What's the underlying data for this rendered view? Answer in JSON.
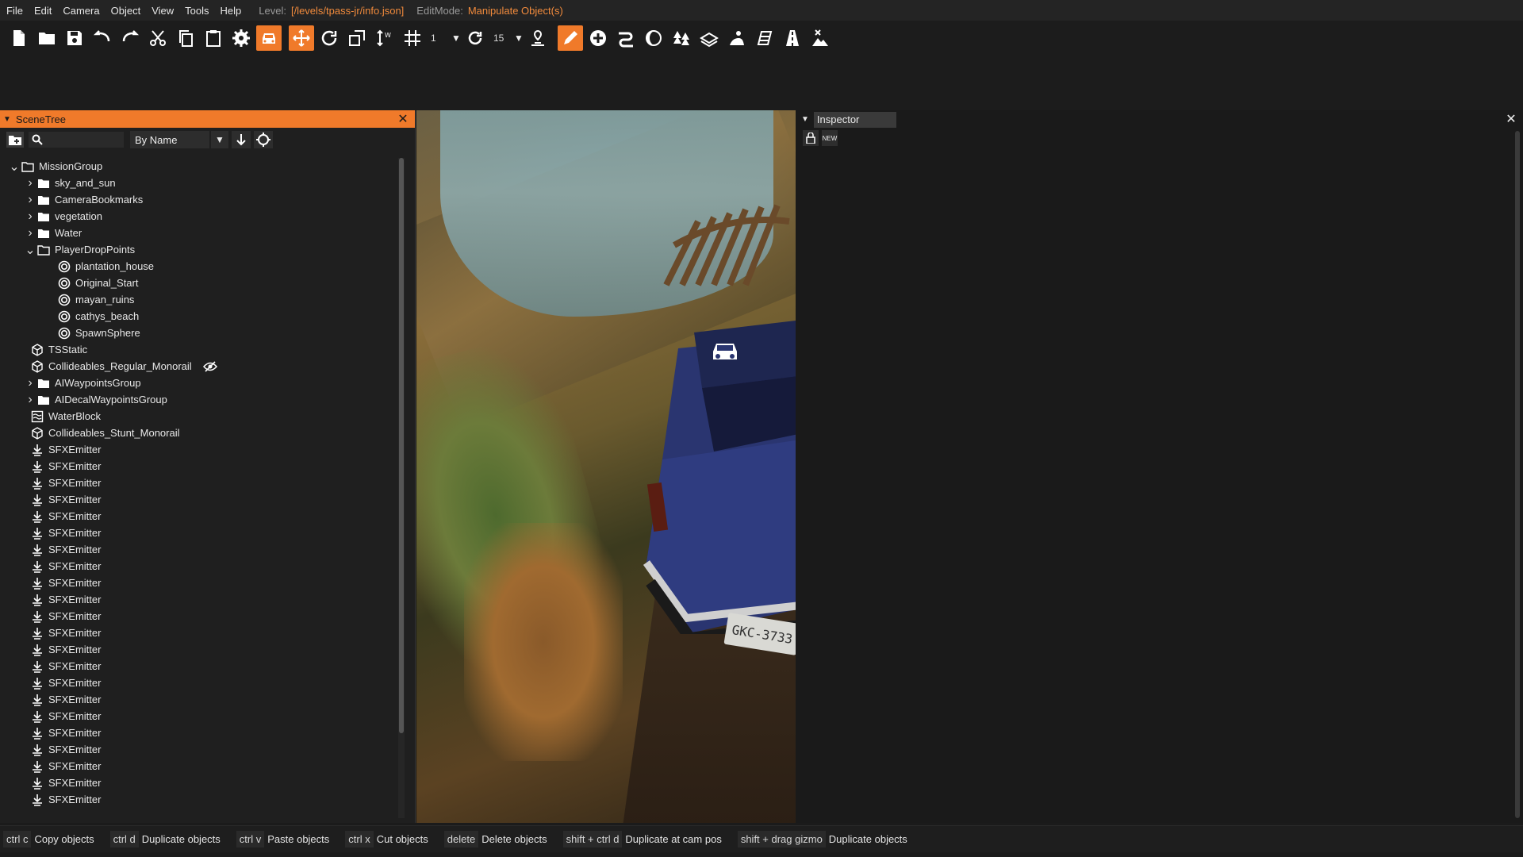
{
  "menubar": {
    "items": [
      "File",
      "Edit",
      "Camera",
      "Object",
      "View",
      "Tools",
      "Help"
    ],
    "level_label": "Level:",
    "level_value": "[/levels/tpass-jr/info.json]",
    "editmode_label": "EditMode:",
    "editmode_value": "Manipulate Object(s)"
  },
  "toolbar": {
    "grid_value": "1",
    "angle_value": "15",
    "icons": [
      "new-file-icon",
      "open-folder-icon",
      "save-icon",
      "undo-icon",
      "redo-icon",
      "cut-icon",
      "copy-icon",
      "paste-icon",
      "settings-icon",
      "vehicle-icon",
      "translate-icon",
      "rotate-icon",
      "scale-icon",
      "axis-icon",
      "grid-snap-icon",
      "rotate-snap-icon",
      "terrain-icon",
      "pencil-icon",
      "add-icon",
      "road-icon",
      "decal-icon",
      "forest-icon",
      "mesh-icon",
      "spawn-icon",
      "river-icon",
      "road-architect-icon",
      "terrain-brush-icon"
    ],
    "accent": "#f07a2a"
  },
  "scenetree": {
    "title": "SceneTree",
    "sort_label": "By Name",
    "items": [
      {
        "label": "MissionGroup",
        "depth": 0,
        "arrow": "down",
        "icon": "folder-open"
      },
      {
        "label": "sky_and_sun",
        "depth": 1,
        "arrow": "right",
        "icon": "folder"
      },
      {
        "label": "CameraBookmarks",
        "depth": 1,
        "arrow": "right",
        "icon": "folder"
      },
      {
        "label": "vegetation",
        "depth": 1,
        "arrow": "right",
        "icon": "folder"
      },
      {
        "label": "Water",
        "depth": 1,
        "arrow": "right",
        "icon": "folder"
      },
      {
        "label": "PlayerDropPoints",
        "depth": 1,
        "arrow": "down",
        "icon": "folder-open"
      },
      {
        "label": "plantation_house",
        "depth": 2,
        "arrow": "none",
        "icon": "spawn"
      },
      {
        "label": "Original_Start",
        "depth": 2,
        "arrow": "none",
        "icon": "spawn"
      },
      {
        "label": "mayan_ruins",
        "depth": 2,
        "arrow": "none",
        "icon": "spawn"
      },
      {
        "label": "cathys_beach",
        "depth": 2,
        "arrow": "none",
        "icon": "spawn"
      },
      {
        "label": "SpawnSphere",
        "depth": 2,
        "arrow": "none",
        "icon": "spawn"
      },
      {
        "label": "TSStatic",
        "depth": 1,
        "arrow": "none",
        "icon": "cube"
      },
      {
        "label": "Collideables_Regular_Monorail",
        "depth": 1,
        "arrow": "none",
        "icon": "cube",
        "hidden": true
      },
      {
        "label": "AIWaypointsGroup",
        "depth": 1,
        "arrow": "right",
        "icon": "folder"
      },
      {
        "label": "AIDecalWaypointsGroup",
        "depth": 1,
        "arrow": "right",
        "icon": "folder"
      },
      {
        "label": "WaterBlock",
        "depth": 1,
        "arrow": "none",
        "icon": "water"
      },
      {
        "label": "Collideables_Stunt_Monorail",
        "depth": 1,
        "arrow": "none",
        "icon": "cube"
      },
      {
        "label": "SFXEmitter",
        "depth": 1,
        "arrow": "none",
        "icon": "sfx"
      },
      {
        "label": "SFXEmitter",
        "depth": 1,
        "arrow": "none",
        "icon": "sfx"
      },
      {
        "label": "SFXEmitter",
        "depth": 1,
        "arrow": "none",
        "icon": "sfx"
      },
      {
        "label": "SFXEmitter",
        "depth": 1,
        "arrow": "none",
        "icon": "sfx"
      },
      {
        "label": "SFXEmitter",
        "depth": 1,
        "arrow": "none",
        "icon": "sfx"
      },
      {
        "label": "SFXEmitter",
        "depth": 1,
        "arrow": "none",
        "icon": "sfx"
      },
      {
        "label": "SFXEmitter",
        "depth": 1,
        "arrow": "none",
        "icon": "sfx"
      },
      {
        "label": "SFXEmitter",
        "depth": 1,
        "arrow": "none",
        "icon": "sfx"
      },
      {
        "label": "SFXEmitter",
        "depth": 1,
        "arrow": "none",
        "icon": "sfx"
      },
      {
        "label": "SFXEmitter",
        "depth": 1,
        "arrow": "none",
        "icon": "sfx"
      },
      {
        "label": "SFXEmitter",
        "depth": 1,
        "arrow": "none",
        "icon": "sfx"
      },
      {
        "label": "SFXEmitter",
        "depth": 1,
        "arrow": "none",
        "icon": "sfx"
      },
      {
        "label": "SFXEmitter",
        "depth": 1,
        "arrow": "none",
        "icon": "sfx"
      },
      {
        "label": "SFXEmitter",
        "depth": 1,
        "arrow": "none",
        "icon": "sfx"
      },
      {
        "label": "SFXEmitter",
        "depth": 1,
        "arrow": "none",
        "icon": "sfx"
      },
      {
        "label": "SFXEmitter",
        "depth": 1,
        "arrow": "none",
        "icon": "sfx"
      },
      {
        "label": "SFXEmitter",
        "depth": 1,
        "arrow": "none",
        "icon": "sfx"
      },
      {
        "label": "SFXEmitter",
        "depth": 1,
        "arrow": "none",
        "icon": "sfx"
      },
      {
        "label": "SFXEmitter",
        "depth": 1,
        "arrow": "none",
        "icon": "sfx"
      },
      {
        "label": "SFXEmitter",
        "depth": 1,
        "arrow": "none",
        "icon": "sfx"
      },
      {
        "label": "SFXEmitter",
        "depth": 1,
        "arrow": "none",
        "icon": "sfx"
      },
      {
        "label": "SFXEmitter",
        "depth": 1,
        "arrow": "none",
        "icon": "sfx"
      }
    ]
  },
  "viewport": {
    "plate_text": "GKC-3733"
  },
  "inspector": {
    "title": "Inspector",
    "new_label": "NEW"
  },
  "statusbar": {
    "shortcuts": [
      {
        "key": "ctrl c",
        "action": "Copy objects"
      },
      {
        "key": "ctrl d",
        "action": "Duplicate objects"
      },
      {
        "key": "ctrl v",
        "action": "Paste objects"
      },
      {
        "key": "ctrl x",
        "action": "Cut objects"
      },
      {
        "key": "delete",
        "action": "Delete objects"
      },
      {
        "key": "shift + ctrl d",
        "action": "Duplicate at cam pos"
      },
      {
        "key": "shift + drag gizmo",
        "action": "Duplicate objects"
      }
    ]
  }
}
